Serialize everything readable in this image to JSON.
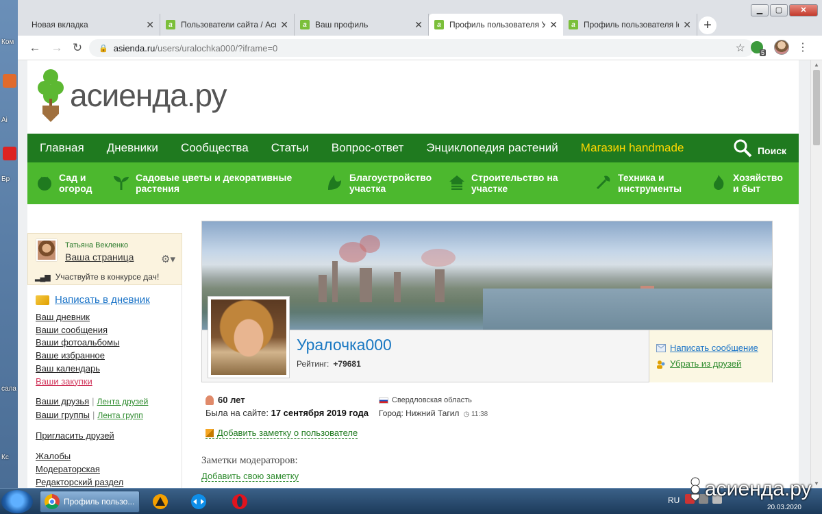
{
  "desktop": {
    "labels": [
      "Ком",
      "Ai",
      "Бр",
      "сала",
      "Кс"
    ]
  },
  "browser": {
    "tabs": [
      {
        "title": "Новая вкладка",
        "favicon": false
      },
      {
        "title": "Пользователи сайта / Аси",
        "favicon": true
      },
      {
        "title": "Ваш профиль",
        "favicon": true
      },
      {
        "title": "Профиль пользователя Ур",
        "favicon": true,
        "active": true
      },
      {
        "title": "Профиль пользователя le",
        "favicon": true
      }
    ],
    "close_glyph": "✕",
    "newtab_glyph": "+",
    "url_host": "asienda.ru",
    "url_path": "/users/uralochka000/?iframe=0",
    "extension_badge": "5",
    "window_buttons": {
      "minimize": "▁",
      "maximize": "▢",
      "close": "✕"
    }
  },
  "site": {
    "logo_text": "асиенда.ру",
    "nav_main": [
      "Главная",
      "Дневники",
      "Сообщества",
      "Статьи",
      "Вопрос-ответ",
      "Энциклопедия растений",
      "Магазин handmade"
    ],
    "search_label": "Поиск",
    "categories": [
      {
        "line1": "Сад и",
        "line2": "огород",
        "icon": "tomato-icon"
      },
      {
        "line1": "Садовые цветы и декоративные",
        "line2": "растения",
        "icon": "sprout-icon"
      },
      {
        "line1": "Благоустройство",
        "line2": "участка",
        "icon": "bush-icon"
      },
      {
        "line1": "Строительство на",
        "line2": "участке",
        "icon": "house-icon"
      },
      {
        "line1": "Техника и",
        "line2": "инструменты",
        "icon": "tools-icon"
      },
      {
        "line1": "Хозяйство",
        "line2": "и быт",
        "icon": "fire-icon"
      }
    ]
  },
  "sidebar": {
    "user_name": "Татьяна Векленко",
    "user_page": "Ваша страница",
    "contest": "Участвуйте в конкурсе дач!",
    "write_diary": "Написать в дневник",
    "links": [
      "Ваш дневник",
      "Ваши сообщения",
      "Ваши фотоальбомы",
      "Ваше избранное",
      "Ваш календарь",
      "Ваши закупки"
    ],
    "friends": "Ваши друзья",
    "friends_feed": "Лента друзей",
    "groups": "Ваши группы",
    "groups_feed": "Лента групп",
    "invite": "Пригласить друзей",
    "complaints": "Жалобы",
    "moderator": "Модераторская",
    "editorial": "Редакторский раздел"
  },
  "profile": {
    "username": "Уралочка000",
    "rating_label": "Рейтинг:",
    "rating_value": "+79681",
    "send_message": "Написать сообщение",
    "remove_friend": "Убрать из друзей",
    "age": "60 лет",
    "last_seen_label": "Была на сайте:",
    "last_seen_value": "17 сентября 2019 года",
    "region": "Свердловская область",
    "city": "Город: Нижний Тагил",
    "local_time": "11:38",
    "add_note": "Добавить заметку о пользователе",
    "moderator_notes_title": "Заметки модераторов:",
    "add_own_note": "Добавить свою заметку"
  },
  "taskbar": {
    "app_title": "Профиль пользо...",
    "lang": "RU",
    "date": "20.03.2020"
  },
  "watermark": "асиенда.ру",
  "colors": {
    "nav_dark": "#1f7a1f",
    "nav_light": "#4cb82e",
    "link_blue": "#1a73c7",
    "shop_yellow": "#ffd700"
  }
}
